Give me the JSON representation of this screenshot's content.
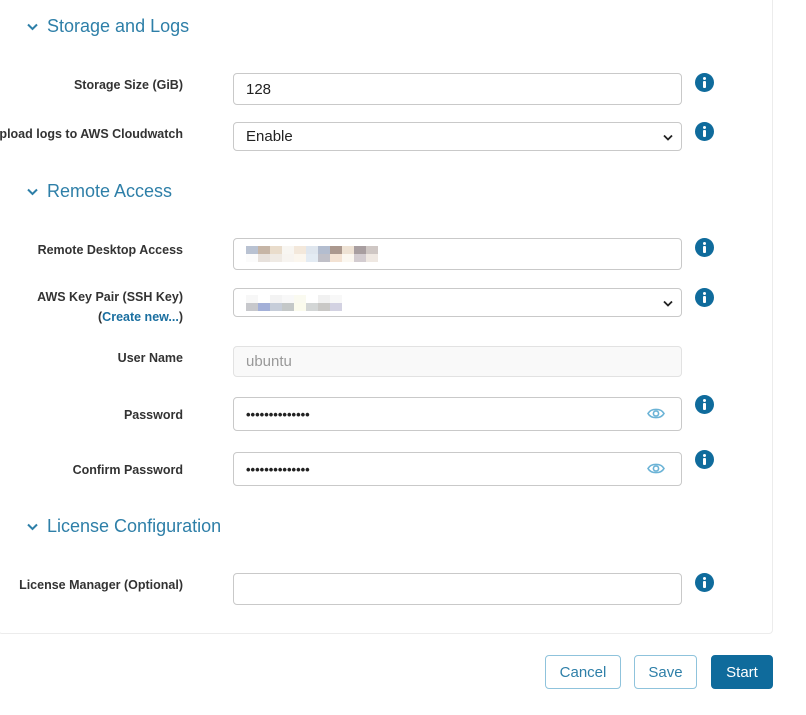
{
  "sections": {
    "storage": {
      "title": "Storage and Logs",
      "storage_size": {
        "label": "Storage Size (GiB)",
        "value": "128"
      },
      "upload_logs": {
        "label": "Upload logs to AWS Cloudwatch",
        "value": "Enable"
      }
    },
    "remote": {
      "title": "Remote Access",
      "remote_desktop": {
        "label": "Remote Desktop Access",
        "value": "[redacted]"
      },
      "key_pair": {
        "label": "AWS Key Pair (SSH Key)",
        "create_prefix": "(",
        "create_link": "Create new...",
        "create_suffix": ")",
        "value": "[redacted]"
      },
      "user_name": {
        "label": "User Name",
        "placeholder": "ubuntu"
      },
      "password": {
        "label": "Password",
        "value": "••••••••••••••"
      },
      "confirm_password": {
        "label": "Confirm Password",
        "value": "••••••••••••••"
      }
    },
    "license": {
      "title": "License Configuration",
      "license_manager": {
        "label": "License Manager (Optional)",
        "value": ""
      }
    }
  },
  "footer": {
    "cancel_label": "Cancel",
    "save_label": "Save",
    "start_label": "Start"
  },
  "colors": {
    "accent": "#2e7fa8",
    "primary_button": "#0f6b9c",
    "info_icon": "#0f6b9c",
    "eye_icon": "#6bb3d6"
  }
}
